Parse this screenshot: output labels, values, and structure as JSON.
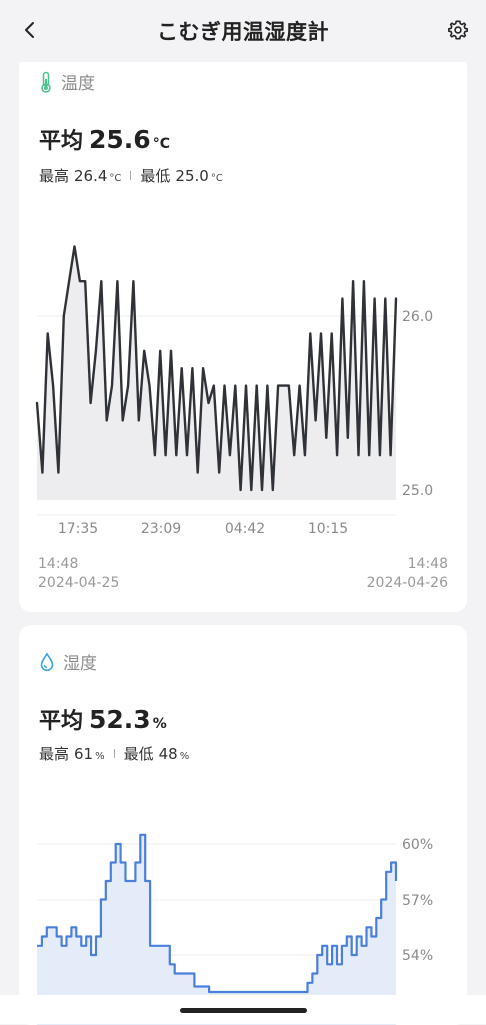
{
  "header": {
    "title": "こむぎ用温湿度計",
    "back_icon": "chevron-left-icon",
    "settings_icon": "gear-icon"
  },
  "temperature": {
    "label": "温度",
    "icon": "thermometer-icon",
    "icon_color": "#4cc48c",
    "avg_label": "平均",
    "avg_value": "25.6",
    "unit": "°C",
    "max_label": "最高",
    "max_value": "26.4",
    "min_label": "最低",
    "min_value": "25.0",
    "chart_data": {
      "type": "line",
      "x_ticks": [
        "17:35",
        "23:09",
        "04:42",
        "10:15"
      ],
      "y_ticks": [
        "26.0",
        "25.0"
      ],
      "ylim": [
        24.9,
        26.4
      ],
      "grid": true,
      "line_color": "#2f3238",
      "values": [
        25.5,
        25.1,
        25.9,
        25.6,
        25.1,
        26.0,
        26.2,
        26.4,
        26.2,
        26.2,
        25.5,
        25.8,
        26.2,
        25.4,
        25.6,
        26.2,
        25.4,
        25.6,
        26.2,
        25.4,
        25.8,
        25.6,
        25.2,
        25.8,
        25.2,
        25.8,
        25.2,
        25.7,
        25.2,
        25.7,
        25.1,
        25.7,
        25.5,
        25.6,
        25.1,
        25.6,
        25.2,
        25.6,
        25.0,
        25.6,
        25.0,
        25.6,
        25.0,
        25.6,
        25.0,
        25.6,
        25.6,
        25.6,
        25.2,
        25.6,
        25.2,
        25.9,
        25.4,
        25.9,
        25.3,
        25.9,
        25.2,
        26.1,
        25.3,
        26.2,
        25.2,
        26.2,
        25.2,
        26.1,
        25.2,
        26.1,
        25.2,
        26.1
      ]
    },
    "start_time": "14:48",
    "start_date": "2024-04-25",
    "end_time": "14:48",
    "end_date": "2024-04-26"
  },
  "humidity": {
    "label": "湿度",
    "icon": "water-drop-icon",
    "icon_color": "#3aa6e0",
    "avg_label": "平均",
    "avg_value": "52.3",
    "unit": "%",
    "max_label": "最高",
    "max_value": "61",
    "min_label": "最低",
    "min_value": "48",
    "chart_data": {
      "type": "area",
      "y_ticks": [
        "60%",
        "57%",
        "54%"
      ],
      "ylim": [
        52,
        61
      ],
      "grid": true,
      "line_color": "#4a7fdc",
      "fill_color": "#e4ecfa",
      "values": [
        54.5,
        55,
        55.5,
        55.5,
        55,
        54.5,
        55,
        55.5,
        55,
        54.5,
        55,
        54,
        55,
        57,
        58,
        59,
        60,
        59,
        58,
        58,
        59,
        60.5,
        58,
        54.5,
        54.5,
        54.5,
        54.5,
        53.5,
        53,
        53,
        53,
        53,
        52.3,
        52.3,
        52.3,
        52,
        52,
        52,
        52,
        52,
        52,
        52,
        52,
        52,
        52,
        52,
        52,
        52,
        52,
        52,
        52,
        52,
        52,
        52,
        52,
        52.5,
        53,
        54,
        54.5,
        53.5,
        54.5,
        53.5,
        54.5,
        55,
        54,
        55,
        54.5,
        55.5,
        55,
        56,
        57,
        58.5,
        59,
        58
      ]
    }
  }
}
